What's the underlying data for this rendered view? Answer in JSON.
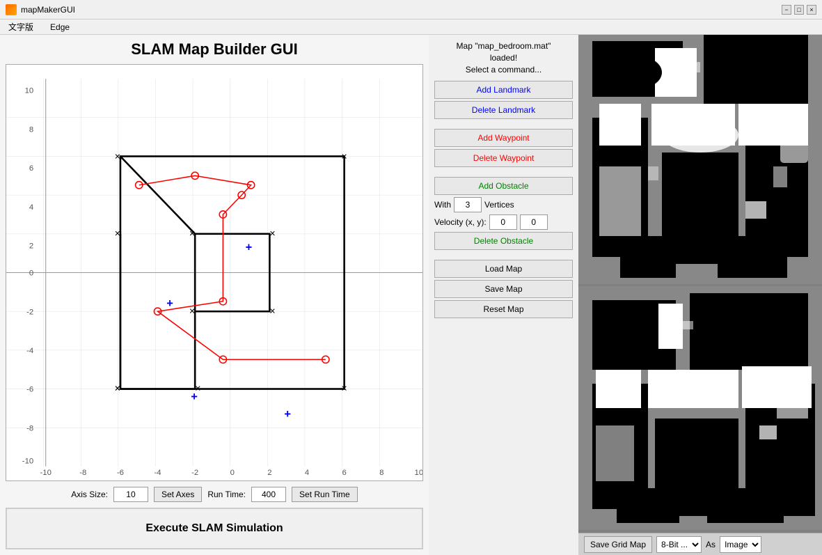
{
  "titleBar": {
    "icon": "matlab-icon",
    "title": "mapMakerGUI",
    "minimizeLabel": "−",
    "maximizeLabel": "□",
    "closeLabel": "×"
  },
  "menuBar": {
    "items": [
      "文字版",
      "Edge"
    ]
  },
  "appTitle": "SLAM Map Builder GUI",
  "status": {
    "line1": "Map \"map_bedroom.mat\"",
    "line2": "loaded!",
    "line3": "Select a command..."
  },
  "buttons": {
    "addLandmark": "Add Landmark",
    "deleteLandmark": "Delete Landmark",
    "addWaypoint": "Add Waypoint",
    "deleteWaypoint": "Delete Waypoint",
    "addObstacle": "Add Obstacle",
    "deleteObstacle": "Delete Obstacle",
    "loadMap": "Load Map",
    "saveMap": "Save Map",
    "resetMap": "Reset Map",
    "execute": "Execute SLAM Simulation",
    "setAxes": "Set Axes",
    "setRunTime": "Set Run Time",
    "saveGridMap": "Save Grid Map"
  },
  "obstacleRow": {
    "withLabel": "With",
    "verticesValue": "3",
    "verticesLabel": "Vertices"
  },
  "velocityRow": {
    "label": "Velocity (x, y):",
    "xValue": "0",
    "yValue": "0"
  },
  "axisControls": {
    "axisSizeLabel": "Axis Size:",
    "axisSizeValue": "10",
    "runTimeLabel": "Run Time:",
    "runTimeValue": "400"
  },
  "saveGrid": {
    "bitDepth": "8-Bit ...",
    "asLabel": "As",
    "format": "Image"
  }
}
